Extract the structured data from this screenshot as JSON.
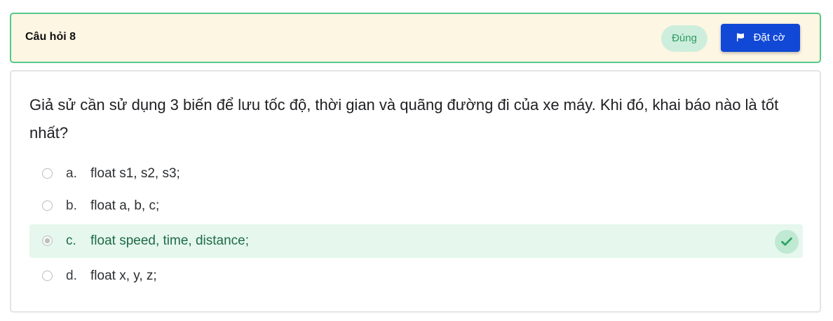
{
  "header": {
    "question_label": "Câu hỏi 8",
    "status": "Đúng",
    "flag_label": "Đặt cờ",
    "flag_icon": "flag-icon"
  },
  "question": {
    "text": "Giả sử cần sử dụng 3 biến để lưu tốc độ, thời gian và quãng đường đi của xe máy. Khi đó, khai báo nào là tốt nhất?"
  },
  "options": [
    {
      "letter": "a.",
      "text": "float s1, s2, s3;",
      "selected": false,
      "correct": false
    },
    {
      "letter": "b.",
      "text": "float a, b, c;",
      "selected": false,
      "correct": false
    },
    {
      "letter": "c.",
      "text": "float speed, time, distance;",
      "selected": true,
      "correct": true
    },
    {
      "letter": "d.",
      "text": "float x, y, z;",
      "selected": false,
      "correct": false
    }
  ],
  "colors": {
    "header_bg": "#fdf6e3",
    "header_border": "#54c98a",
    "correct_bg": "#e6f7ee",
    "correct_text": "#1e6b45",
    "flag_button_bg": "#1148d6",
    "check_icon": "#2ea565"
  }
}
